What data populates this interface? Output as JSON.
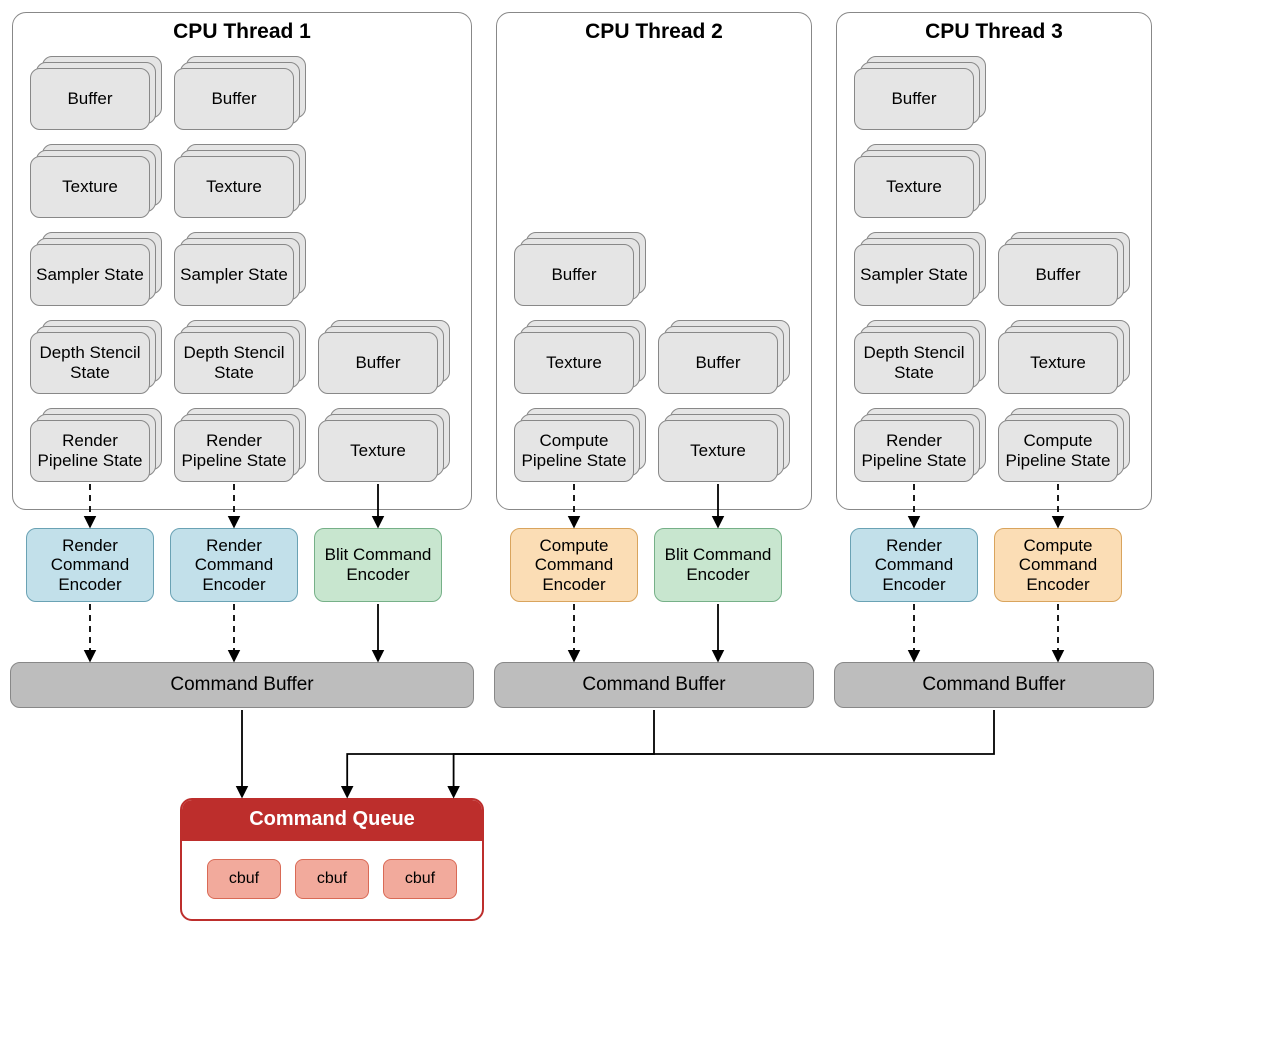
{
  "labels": {
    "buffer": "Buffer",
    "texture": "Texture",
    "sampler": "Sampler State",
    "depth": "Depth Stencil State",
    "rps": "Render Pipeline State",
    "cps": "Compute Pipeline State",
    "rce": "Render Command Encoder",
    "cce": "Compute Command Encoder",
    "bce": "Blit Command Encoder",
    "cbuffer": "Command Buffer",
    "queue": "Command Queue",
    "cbuf": "cbuf"
  },
  "threads": [
    {
      "title": "CPU Thread 1",
      "columns": [
        {
          "stacks": [
            "buffer",
            "texture",
            "sampler",
            "depth",
            "rps"
          ],
          "encoder": "rce",
          "encColor": "blue",
          "arrow": "dashed"
        },
        {
          "stacks": [
            "buffer",
            "texture",
            "sampler",
            "depth",
            "rps"
          ],
          "encoder": "rce",
          "encColor": "blue",
          "arrow": "dashed"
        },
        {
          "stacks": [
            "buffer",
            "texture"
          ],
          "encoder": "bce",
          "encColor": "green",
          "arrow": "solid",
          "offsetRows": 3
        }
      ]
    },
    {
      "title": "CPU Thread 2",
      "columns": [
        {
          "stacks": [
            "buffer",
            "texture",
            "cps"
          ],
          "encoder": "cce",
          "encColor": "orange",
          "arrow": "dashed",
          "offsetRows": 2
        },
        {
          "stacks": [
            "buffer",
            "texture"
          ],
          "encoder": "bce",
          "encColor": "green",
          "arrow": "solid",
          "offsetRows": 3
        }
      ]
    },
    {
      "title": "CPU Thread 3",
      "columns": [
        {
          "stacks": [
            "buffer",
            "texture",
            "sampler",
            "depth",
            "rps"
          ],
          "encoder": "rce",
          "encColor": "blue",
          "arrow": "dashed"
        },
        {
          "stacks": [
            "buffer",
            "texture",
            "cps"
          ],
          "encoder": "cce",
          "encColor": "orange",
          "arrow": "dashed",
          "offsetRows": 2
        }
      ]
    }
  ]
}
